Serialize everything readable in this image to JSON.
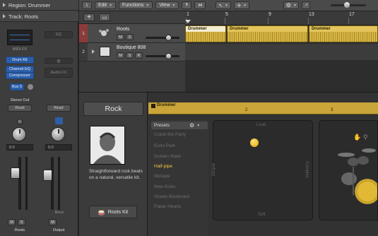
{
  "inspector": {
    "region_label": "Region: Drummer",
    "track_label": "Track: Roots",
    "strip_left": {
      "midi_fx": "MIDI FX",
      "instrument": "Drum Kit",
      "plugin1": "Channel EQ",
      "plugin2": "Compressor",
      "send": "Bus 5",
      "output": "Stereo Out",
      "automation": "Read",
      "value": "0.0",
      "name": "Roots"
    },
    "strip_right": {
      "eq": "EQ",
      "audio_fx": "Audio FX",
      "automation": "Read",
      "value": "0.0",
      "bounce": "Bnce",
      "name": "Output"
    },
    "m_label": "M",
    "s_label": "S"
  },
  "toolbar": {
    "edit": "Edit",
    "functions": "Functions",
    "view": "View"
  },
  "tracks": [
    {
      "num": "1",
      "name": "Roots",
      "m": "M",
      "s": "S"
    },
    {
      "num": "2",
      "name": "Boutique 808",
      "m": "M",
      "s": "S",
      "r": "R"
    }
  ],
  "ruler": {
    "marks": [
      "1",
      "5",
      "9",
      "13",
      "17"
    ]
  },
  "regions": [
    {
      "label": "Drummer"
    },
    {
      "label": "Drummer"
    },
    {
      "label": "Drummer"
    }
  ],
  "drummer": {
    "genre": "Rock",
    "description": "Straightforward rock beats on a natural, versatile kit.",
    "kit_button": "Roots Kit",
    "region_label": "Drummer",
    "bar_marks": [
      "2",
      "3"
    ],
    "presets_title": "Presets",
    "presets": [
      "Crash the Party",
      "Echo Park",
      "Golden State",
      "Half-pipe",
      "Mixtape",
      "New Kicks",
      "Ocean Boulevard",
      "Paper Hearts"
    ],
    "selected_preset": "Half-pipe",
    "xy_labels": {
      "top": "Loud",
      "bottom": "Soft",
      "left": "Simple",
      "right": "Complex"
    }
  },
  "colors": {
    "accent_blue": "#2c5ea8",
    "region_yellow": "#c9a73a",
    "preset_selected": "#f2c744",
    "track_selected": "#8c3b3b"
  }
}
